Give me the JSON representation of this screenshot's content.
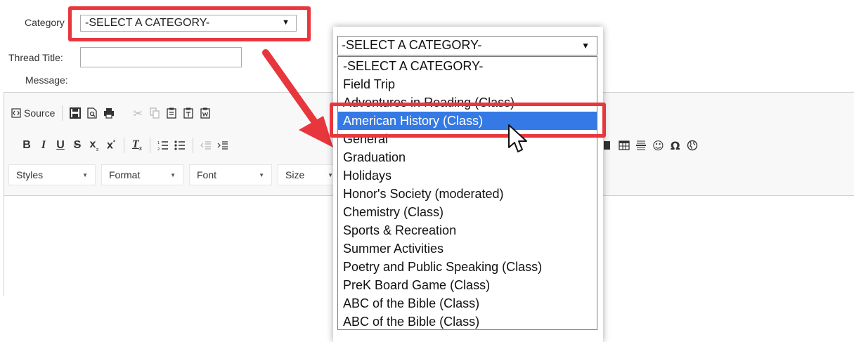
{
  "form": {
    "category_label": "Category",
    "category_value": "-SELECT A CATEGORY-",
    "thread_title_label": "Thread Title:",
    "thread_title_value": "",
    "message_label": "Message:"
  },
  "toolbar": {
    "source_label": "Source",
    "row3": {
      "styles": "Styles",
      "format": "Format",
      "font": "Font",
      "size": "Size"
    }
  },
  "dropdown": {
    "current": "-SELECT A CATEGORY-",
    "options": [
      "-SELECT A CATEGORY-",
      "Field Trip",
      "Adventures in Reading (Class)",
      "American History (Class)",
      "General",
      "Graduation",
      "Holidays",
      "Honor's Society (moderated)",
      "Chemistry (Class)",
      "Sports & Recreation",
      "Summer Activities",
      "Poetry and Public Speaking (Class)",
      "PreK Board Game (Class)",
      "ABC of the Bible (Class)",
      "ABC of the Bible (Class)"
    ],
    "highlighted_option": "American History (Class)"
  },
  "colors": {
    "annotation_red": "#e8363d",
    "highlight_blue": "#3479e4"
  },
  "icons": [
    "source-icon",
    "save-icon",
    "preview-icon",
    "print-icon",
    "cut-icon",
    "copy-icon",
    "paste-icon",
    "paste-text-icon",
    "paste-word-icon",
    "bold-icon",
    "italic-icon",
    "underline-icon",
    "strikethrough-icon",
    "subscript-icon",
    "superscript-icon",
    "remove-format-icon",
    "numbered-list-icon",
    "bulleted-list-icon",
    "outdent-icon",
    "indent-icon",
    "image-icon",
    "table-icon",
    "horizontal-line-icon",
    "smiley-icon",
    "special-char-icon",
    "iframe-icon",
    "mouse-cursor-icon"
  ]
}
